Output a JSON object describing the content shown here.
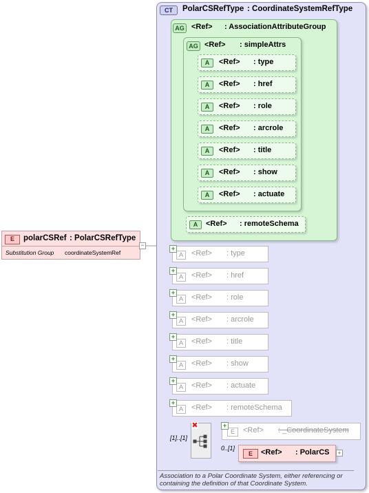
{
  "root_element": {
    "badge": "E",
    "name": "polarCSRef",
    "type": ": PolarCSRefType",
    "substitution_label": "Substitution Group",
    "substitution_value": "coordinateSystemRef"
  },
  "complex_type": {
    "badge": "CT",
    "name": "PolarCSRefType",
    "base": ": CoordinateSystemRefType",
    "description": "Association to a Polar Coordinate System, either referencing or containing the definition of that Coordinate System."
  },
  "association_group": {
    "badge": "AG",
    "ref": "<Ref>",
    "name": ": AssociationAttributeGroup",
    "simple_attrs": {
      "badge": "AG",
      "ref": "<Ref>",
      "name": ": simpleAttrs",
      "attributes": [
        {
          "badge": "A",
          "ref": "<Ref>",
          "name": ": type"
        },
        {
          "badge": "A",
          "ref": "<Ref>",
          "name": ": href"
        },
        {
          "badge": "A",
          "ref": "<Ref>",
          "name": ": role"
        },
        {
          "badge": "A",
          "ref": "<Ref>",
          "name": ": arcrole"
        },
        {
          "badge": "A",
          "ref": "<Ref>",
          "name": ": title"
        },
        {
          "badge": "A",
          "ref": "<Ref>",
          "name": ": show"
        },
        {
          "badge": "A",
          "ref": "<Ref>",
          "name": ": actuate"
        }
      ]
    },
    "remote_schema": {
      "badge": "A",
      "ref": "<Ref>",
      "name": ": remoteSchema"
    }
  },
  "flattened_attributes": [
    {
      "badge": "A",
      "ref": "<Ref>",
      "name": ": type"
    },
    {
      "badge": "A",
      "ref": "<Ref>",
      "name": ": href"
    },
    {
      "badge": "A",
      "ref": "<Ref>",
      "name": ": role"
    },
    {
      "badge": "A",
      "ref": "<Ref>",
      "name": ": arcrole"
    },
    {
      "badge": "A",
      "ref": "<Ref>",
      "name": ": title"
    },
    {
      "badge": "A",
      "ref": "<Ref>",
      "name": ": show"
    },
    {
      "badge": "A",
      "ref": "<Ref>",
      "name": ": actuate"
    },
    {
      "badge": "A",
      "ref": "<Ref>",
      "name": ": remoteSchema"
    }
  ],
  "choice": {
    "multiplicity": "[1]..[1]",
    "abstract_element": {
      "badge": "E",
      "ref": "<Ref>",
      "name": ": _CoordinateSystem"
    },
    "polar_element": {
      "badge": "E",
      "ref": "<Ref>",
      "name": ": PolarCS",
      "multiplicity": "0..[1]"
    }
  },
  "colors": {
    "complex_type_fill": "#e2e2f8",
    "group_fill": "#d5f5d5",
    "element_fill": "#fde1e1",
    "plus_green": "#2f8f2f",
    "remove_red": "#e02020"
  }
}
